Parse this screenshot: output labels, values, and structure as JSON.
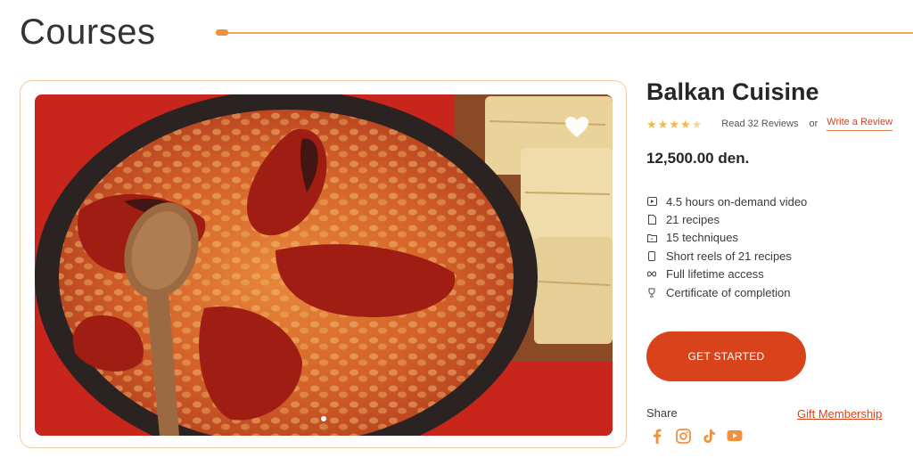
{
  "header": {
    "title": "Courses"
  },
  "course": {
    "name": "Balkan Cuisine",
    "rating": 4.5,
    "rating_max": 5,
    "reviews_text": "Read 32 Reviews",
    "or_text": "or",
    "write_review": "Write a Review",
    "price": "12,500.00 den."
  },
  "features": [
    {
      "icon": "video-icon",
      "label": "4.5 hours on-demand video"
    },
    {
      "icon": "document-icon",
      "label": "21 recipes"
    },
    {
      "icon": "folder-icon",
      "label": "15 techniques"
    },
    {
      "icon": "phone-icon",
      "label": "Short reels of 21 recipes"
    },
    {
      "icon": "infinity-icon",
      "label": "Full lifetime access"
    },
    {
      "icon": "trophy-icon",
      "label": "Certificate of completion"
    }
  ],
  "cta": {
    "label": "GET STARTED"
  },
  "share": {
    "label": "Share",
    "gift_label": "Gift Membership",
    "socials": [
      "facebook-icon",
      "instagram-icon",
      "tiktok-icon",
      "youtube-icon"
    ]
  },
  "carousel": {
    "slides": 3,
    "active": 1
  },
  "colors": {
    "accent": "#d9431c",
    "accent_light": "#f0a35e",
    "star": "#f2b84b"
  }
}
